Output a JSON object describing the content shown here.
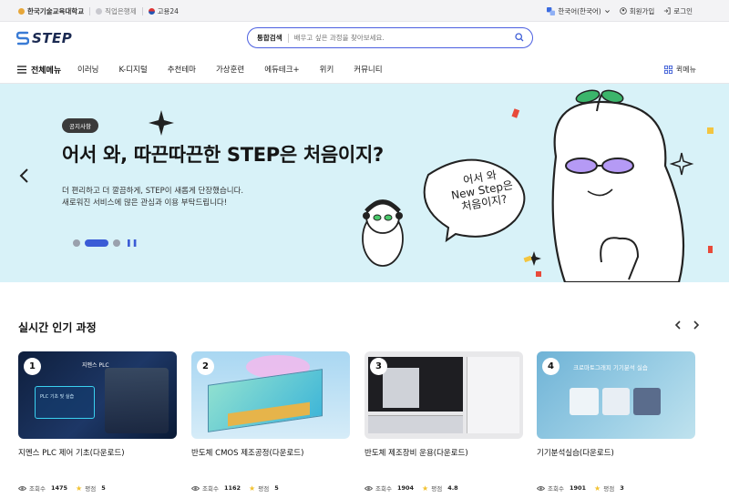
{
  "topbar": {
    "links": [
      {
        "label": "한국기술교육대학교"
      },
      {
        "label": "직업은행제"
      },
      {
        "label": "고용24"
      }
    ],
    "language": "한국어(한국어)",
    "signup": "회원가입",
    "login": "로그인"
  },
  "header": {
    "logo_text": "STEP",
    "search_scope": "통합검색",
    "search_placeholder": "배우고 싶은 과정을 찾아보세요."
  },
  "nav": {
    "all_menu": "전체메뉴",
    "items": [
      "이러닝",
      "K-디지털",
      "추천테마",
      "가상훈련",
      "에듀테크+",
      "위키",
      "커뮤니티"
    ],
    "quick_menu": "퀵메뉴"
  },
  "banner": {
    "badge": "공지사항",
    "headline": "어서 와, 따끈따끈한 STEP은 처음이지?",
    "sub_line1": "더 편리하고 더 깔끔하게, STEP이 새롭게 단장했습니다.",
    "sub_line2": "새로워진 서비스에 많은 관심과 이용 부탁드립니다!",
    "bubble_lines": [
      "어서 와",
      "New Step은",
      "처음이지?"
    ],
    "accent_color": "#3b5cd6",
    "background_color": "#d8f2f8"
  },
  "popular": {
    "title": "실시간 인기 과정",
    "views_label": "조회수",
    "rating_label": "평점",
    "courses": [
      {
        "rank": "1",
        "title": "지멘스 PLC 제어 기초(다운로드)",
        "views": "1475",
        "rating": "5",
        "thumb_caption": "지멘스 PLC",
        "thumb_sub": "PLC 기초 및 실습"
      },
      {
        "rank": "2",
        "title": "반도체 CMOS 제조공정(다운로드)",
        "views": "1162",
        "rating": "5"
      },
      {
        "rank": "3",
        "title": "반도체 제조장비 운용(다운로드)",
        "views": "1904",
        "rating": "4.8"
      },
      {
        "rank": "4",
        "title": "기기분석실습(다운로드)",
        "views": "1901",
        "rating": "3",
        "thumb_caption": "크로마토그래피 기기분석 실습"
      }
    ]
  }
}
